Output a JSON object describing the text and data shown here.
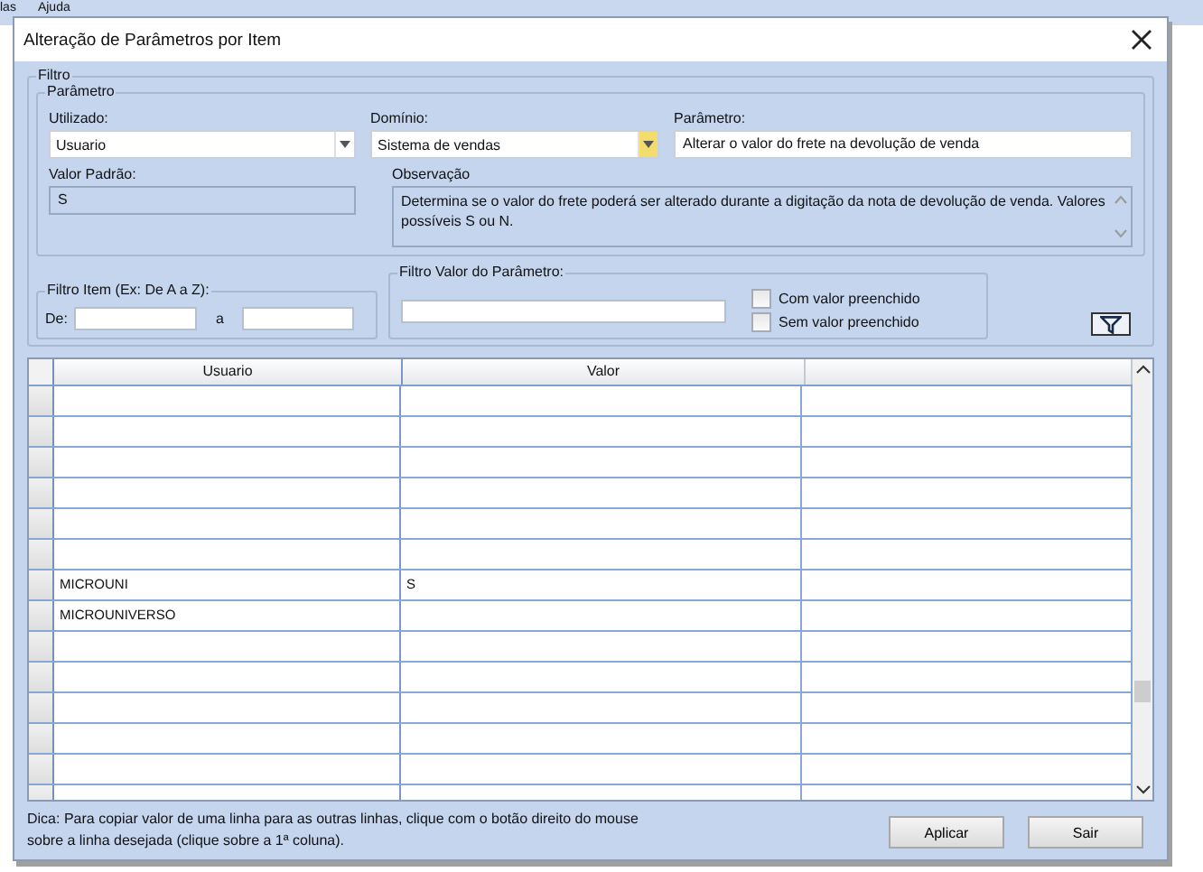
{
  "background_menu": [
    "las",
    "Ajuda"
  ],
  "window": {
    "title": "Alteração de Parâmetros por Item"
  },
  "filtro": {
    "legend": "Filtro",
    "parametro": {
      "legend": "Parâmetro",
      "utilizado": {
        "label": "Utilizado:",
        "value": "Usuario"
      },
      "dominio": {
        "label": "Domínio:",
        "value": "Sistema de vendas"
      },
      "parametro": {
        "label": "Parâmetro:",
        "value": "Alterar o valor do frete na devolução de venda"
      },
      "valor_padrao": {
        "label": "Valor Padrão:",
        "value": "S"
      },
      "observacao": {
        "label": "Observação",
        "value": "Determina se o valor do frete poderá ser alterado durante a digitação da nota de devolução de venda. Valores possíveis S ou N."
      }
    },
    "filtro_item": {
      "legend": "Filtro Item (Ex: De A a Z):",
      "de_label": "De:",
      "a_label": "a"
    },
    "filtro_valor": {
      "legend": "Filtro Valor do Parâmetro:",
      "checkboxes": [
        {
          "label": "Com valor preenchido",
          "checked": false
        },
        {
          "label": "Sem valor preenchido",
          "checked": false
        }
      ]
    }
  },
  "table": {
    "columns": [
      "Usuario",
      "Valor"
    ],
    "rows": [
      [
        "",
        ""
      ],
      [
        "",
        ""
      ],
      [
        "",
        ""
      ],
      [
        "",
        ""
      ],
      [
        "",
        ""
      ],
      [
        "",
        ""
      ],
      [
        "MICROUNI",
        "S"
      ],
      [
        "MICROUNIVERSO",
        ""
      ],
      [
        "",
        ""
      ],
      [
        "",
        ""
      ],
      [
        "",
        ""
      ],
      [
        "",
        ""
      ],
      [
        "",
        ""
      ],
      [
        "",
        ""
      ]
    ]
  },
  "hint": "Dica: Para copiar valor de uma linha para as outras linhas, clique com o botão direito do mouse sobre a linha desejada (clique sobre a 1ª coluna).",
  "buttons": [
    "Aplicar",
    "Sair"
  ]
}
